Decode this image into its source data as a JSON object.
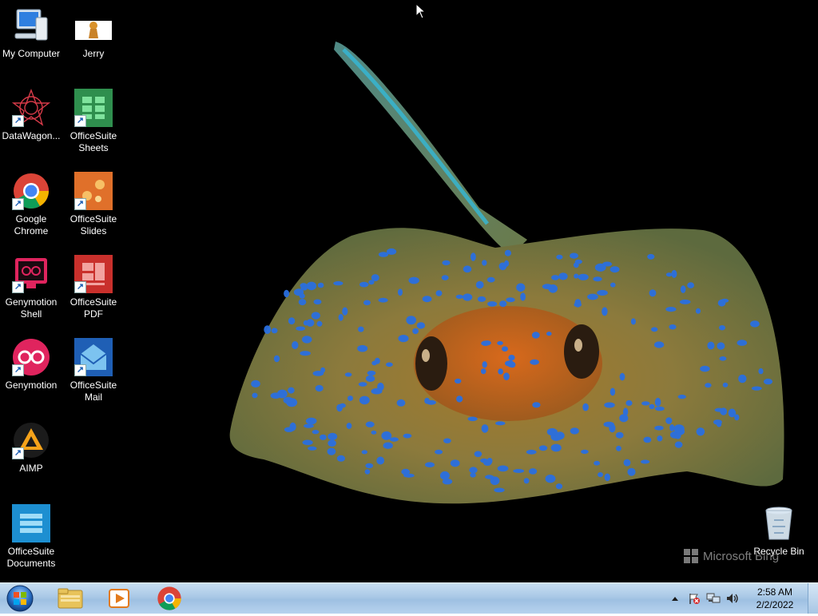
{
  "desktop": {
    "icons": [
      {
        "label": "My Computer",
        "icon": "computer-icon",
        "shortcut": false
      },
      {
        "label": "Jerry",
        "icon": "jerry-image-icon",
        "shortcut": false
      },
      {
        "label": "DataWagon...",
        "icon": "datawagon-icon",
        "shortcut": true
      },
      {
        "label": "OfficeSuite Sheets",
        "icon": "sheets-icon",
        "shortcut": true
      },
      {
        "label": "Google Chrome",
        "icon": "chrome-icon",
        "shortcut": true
      },
      {
        "label": "OfficeSuite Slides",
        "icon": "slides-icon",
        "shortcut": true
      },
      {
        "label": "Genymotion Shell",
        "icon": "genymotion-shell-icon",
        "shortcut": true
      },
      {
        "label": "OfficeSuite PDF",
        "icon": "pdf-icon",
        "shortcut": true
      },
      {
        "label": "Genymotion",
        "icon": "genymotion-icon",
        "shortcut": true
      },
      {
        "label": "OfficeSuite Mail",
        "icon": "mail-icon",
        "shortcut": true
      },
      {
        "label": "AIMP",
        "icon": "aimp-icon",
        "shortcut": true
      },
      {
        "label": "OfficeSuite Documents",
        "icon": "documents-icon",
        "shortcut": false
      },
      {
        "label": "Recycle Bin",
        "icon": "recycle-bin-icon",
        "shortcut": false
      }
    ],
    "watermark": "Microsoft Bing"
  },
  "taskbar": {
    "start": "start-orb-icon",
    "pinned": [
      "file-explorer-icon",
      "media-player-icon",
      "chrome-icon"
    ],
    "tray": [
      "show-hidden-icons-arrow",
      "action-center-flag-icon",
      "network-icon",
      "volume-icon"
    ],
    "time": "2:58 AM",
    "date": "2/2/2022"
  },
  "colors": {
    "taskbar": "#a9c8e6",
    "desktop_bg": "#000000",
    "ray_body": "#8a7a3a",
    "ray_spots": "#2a6fe0"
  }
}
